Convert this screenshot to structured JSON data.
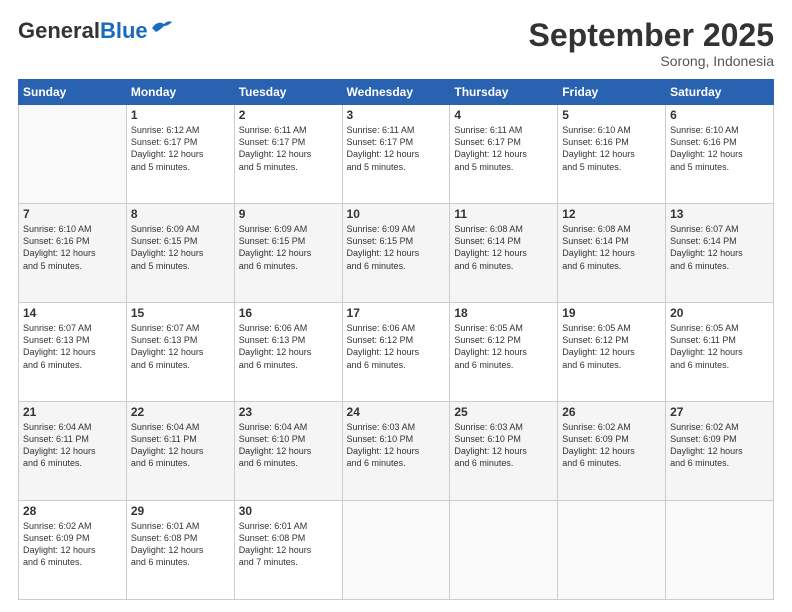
{
  "header": {
    "logo_general": "General",
    "logo_blue": "Blue",
    "month": "September 2025",
    "location": "Sorong, Indonesia"
  },
  "weekdays": [
    "Sunday",
    "Monday",
    "Tuesday",
    "Wednesday",
    "Thursday",
    "Friday",
    "Saturday"
  ],
  "weeks": [
    [
      {
        "day": "",
        "empty": true
      },
      {
        "day": "1",
        "sunrise": "6:12 AM",
        "sunset": "6:17 PM",
        "daylight": "12 hours and 5 minutes."
      },
      {
        "day": "2",
        "sunrise": "6:11 AM",
        "sunset": "6:17 PM",
        "daylight": "12 hours and 5 minutes."
      },
      {
        "day": "3",
        "sunrise": "6:11 AM",
        "sunset": "6:17 PM",
        "daylight": "12 hours and 5 minutes."
      },
      {
        "day": "4",
        "sunrise": "6:11 AM",
        "sunset": "6:17 PM",
        "daylight": "12 hours and 5 minutes."
      },
      {
        "day": "5",
        "sunrise": "6:10 AM",
        "sunset": "6:16 PM",
        "daylight": "12 hours and 5 minutes."
      },
      {
        "day": "6",
        "sunrise": "6:10 AM",
        "sunset": "6:16 PM",
        "daylight": "12 hours and 5 minutes."
      }
    ],
    [
      {
        "day": "7",
        "sunrise": "6:10 AM",
        "sunset": "6:16 PM",
        "daylight": "12 hours and 5 minutes."
      },
      {
        "day": "8",
        "sunrise": "6:09 AM",
        "sunset": "6:15 PM",
        "daylight": "12 hours and 5 minutes."
      },
      {
        "day": "9",
        "sunrise": "6:09 AM",
        "sunset": "6:15 PM",
        "daylight": "12 hours and 6 minutes."
      },
      {
        "day": "10",
        "sunrise": "6:09 AM",
        "sunset": "6:15 PM",
        "daylight": "12 hours and 6 minutes."
      },
      {
        "day": "11",
        "sunrise": "6:08 AM",
        "sunset": "6:14 PM",
        "daylight": "12 hours and 6 minutes."
      },
      {
        "day": "12",
        "sunrise": "6:08 AM",
        "sunset": "6:14 PM",
        "daylight": "12 hours and 6 minutes."
      },
      {
        "day": "13",
        "sunrise": "6:07 AM",
        "sunset": "6:14 PM",
        "daylight": "12 hours and 6 minutes."
      }
    ],
    [
      {
        "day": "14",
        "sunrise": "6:07 AM",
        "sunset": "6:13 PM",
        "daylight": "12 hours and 6 minutes."
      },
      {
        "day": "15",
        "sunrise": "6:07 AM",
        "sunset": "6:13 PM",
        "daylight": "12 hours and 6 minutes."
      },
      {
        "day": "16",
        "sunrise": "6:06 AM",
        "sunset": "6:13 PM",
        "daylight": "12 hours and 6 minutes."
      },
      {
        "day": "17",
        "sunrise": "6:06 AM",
        "sunset": "6:12 PM",
        "daylight": "12 hours and 6 minutes."
      },
      {
        "day": "18",
        "sunrise": "6:05 AM",
        "sunset": "6:12 PM",
        "daylight": "12 hours and 6 minutes."
      },
      {
        "day": "19",
        "sunrise": "6:05 AM",
        "sunset": "6:12 PM",
        "daylight": "12 hours and 6 minutes."
      },
      {
        "day": "20",
        "sunrise": "6:05 AM",
        "sunset": "6:11 PM",
        "daylight": "12 hours and 6 minutes."
      }
    ],
    [
      {
        "day": "21",
        "sunrise": "6:04 AM",
        "sunset": "6:11 PM",
        "daylight": "12 hours and 6 minutes."
      },
      {
        "day": "22",
        "sunrise": "6:04 AM",
        "sunset": "6:11 PM",
        "daylight": "12 hours and 6 minutes."
      },
      {
        "day": "23",
        "sunrise": "6:04 AM",
        "sunset": "6:10 PM",
        "daylight": "12 hours and 6 minutes."
      },
      {
        "day": "24",
        "sunrise": "6:03 AM",
        "sunset": "6:10 PM",
        "daylight": "12 hours and 6 minutes."
      },
      {
        "day": "25",
        "sunrise": "6:03 AM",
        "sunset": "6:10 PM",
        "daylight": "12 hours and 6 minutes."
      },
      {
        "day": "26",
        "sunrise": "6:02 AM",
        "sunset": "6:09 PM",
        "daylight": "12 hours and 6 minutes."
      },
      {
        "day": "27",
        "sunrise": "6:02 AM",
        "sunset": "6:09 PM",
        "daylight": "12 hours and 6 minutes."
      }
    ],
    [
      {
        "day": "28",
        "sunrise": "6:02 AM",
        "sunset": "6:09 PM",
        "daylight": "12 hours and 6 minutes."
      },
      {
        "day": "29",
        "sunrise": "6:01 AM",
        "sunset": "6:08 PM",
        "daylight": "12 hours and 6 minutes."
      },
      {
        "day": "30",
        "sunrise": "6:01 AM",
        "sunset": "6:08 PM",
        "daylight": "12 hours and 7 minutes."
      },
      {
        "day": "",
        "empty": true
      },
      {
        "day": "",
        "empty": true
      },
      {
        "day": "",
        "empty": true
      },
      {
        "day": "",
        "empty": true
      }
    ]
  ]
}
